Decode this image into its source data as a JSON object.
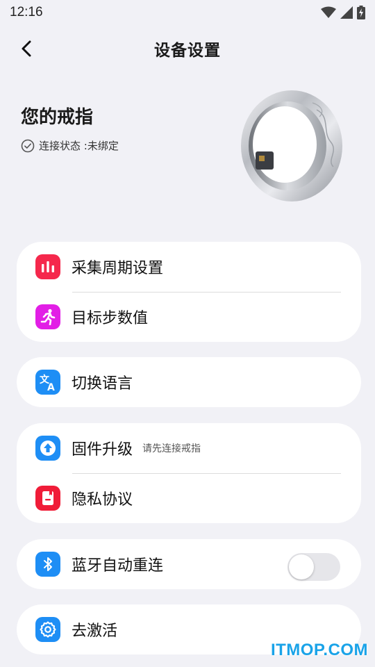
{
  "status_bar": {
    "time": "12:16"
  },
  "header": {
    "title": "设备设置"
  },
  "device": {
    "name": "您的戒指",
    "status": "连接状态 :未绑定"
  },
  "cards": [
    {
      "items": [
        {
          "label": "采集周期设置",
          "icon": "bar-chart-icon",
          "color": "#f5284c"
        },
        {
          "label": "目标步数值",
          "icon": "running-person-icon",
          "color": "#e21ee6"
        }
      ]
    },
    {
      "items": [
        {
          "label": "切换语言",
          "icon": "translate-icon",
          "color": "#1e8ef5"
        }
      ]
    },
    {
      "items": [
        {
          "label": "固件升级",
          "hint": "请先连接戒指",
          "icon": "upload-arrow-icon",
          "color": "#1e8ef5"
        },
        {
          "label": "隐私协议",
          "icon": "document-icon",
          "color": "#f01c38"
        }
      ]
    },
    {
      "items": [
        {
          "label": "蓝牙自动重连",
          "icon": "bluetooth-icon",
          "color": "#1e8ef5",
          "toggle_on": false
        }
      ]
    },
    {
      "items": [
        {
          "label": "去激活",
          "icon": "gear-icon",
          "color": "#1e8ef5"
        }
      ]
    }
  ],
  "watermark": "ITMOP.COM"
}
